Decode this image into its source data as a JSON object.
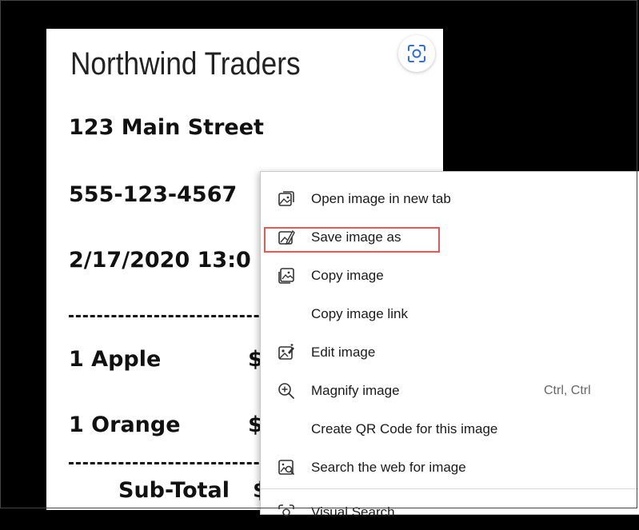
{
  "receipt": {
    "store_name": "Northwind Traders",
    "address": "123 Main Street",
    "phone": "555-123-4567",
    "datetime": "2/17/2020   13:0",
    "items": [
      {
        "name": "1 Apple",
        "price": "$"
      },
      {
        "name": "1 Orange",
        "price": "$"
      }
    ],
    "subtotal_label": "Sub-Total",
    "subtotal_price": "$"
  },
  "visual_search": {
    "icon": "visual-search-icon"
  },
  "context_menu": {
    "items": [
      {
        "label": "Open image in new tab",
        "icon": "open-in-new-tab-icon",
        "shortcut": ""
      },
      {
        "label": "Save image as",
        "icon": "save-image-icon",
        "shortcut": "",
        "highlighted": true
      },
      {
        "label": "Copy image",
        "icon": "copy-image-icon",
        "shortcut": ""
      },
      {
        "label": "Copy image link",
        "icon": "",
        "shortcut": ""
      },
      {
        "label": "Edit image",
        "icon": "edit-image-icon",
        "shortcut": ""
      },
      {
        "label": "Magnify image",
        "icon": "magnify-icon",
        "shortcut": "Ctrl, Ctrl"
      },
      {
        "label": "Create QR Code for this image",
        "icon": "",
        "shortcut": ""
      },
      {
        "label": "Search the web for image",
        "icon": "search-web-image-icon",
        "shortcut": ""
      },
      {
        "label": "Visual Search",
        "icon": "visual-search-icon",
        "shortcut": ""
      }
    ]
  },
  "colors": {
    "highlight_border": "#e05a5a",
    "background": "#000000"
  }
}
